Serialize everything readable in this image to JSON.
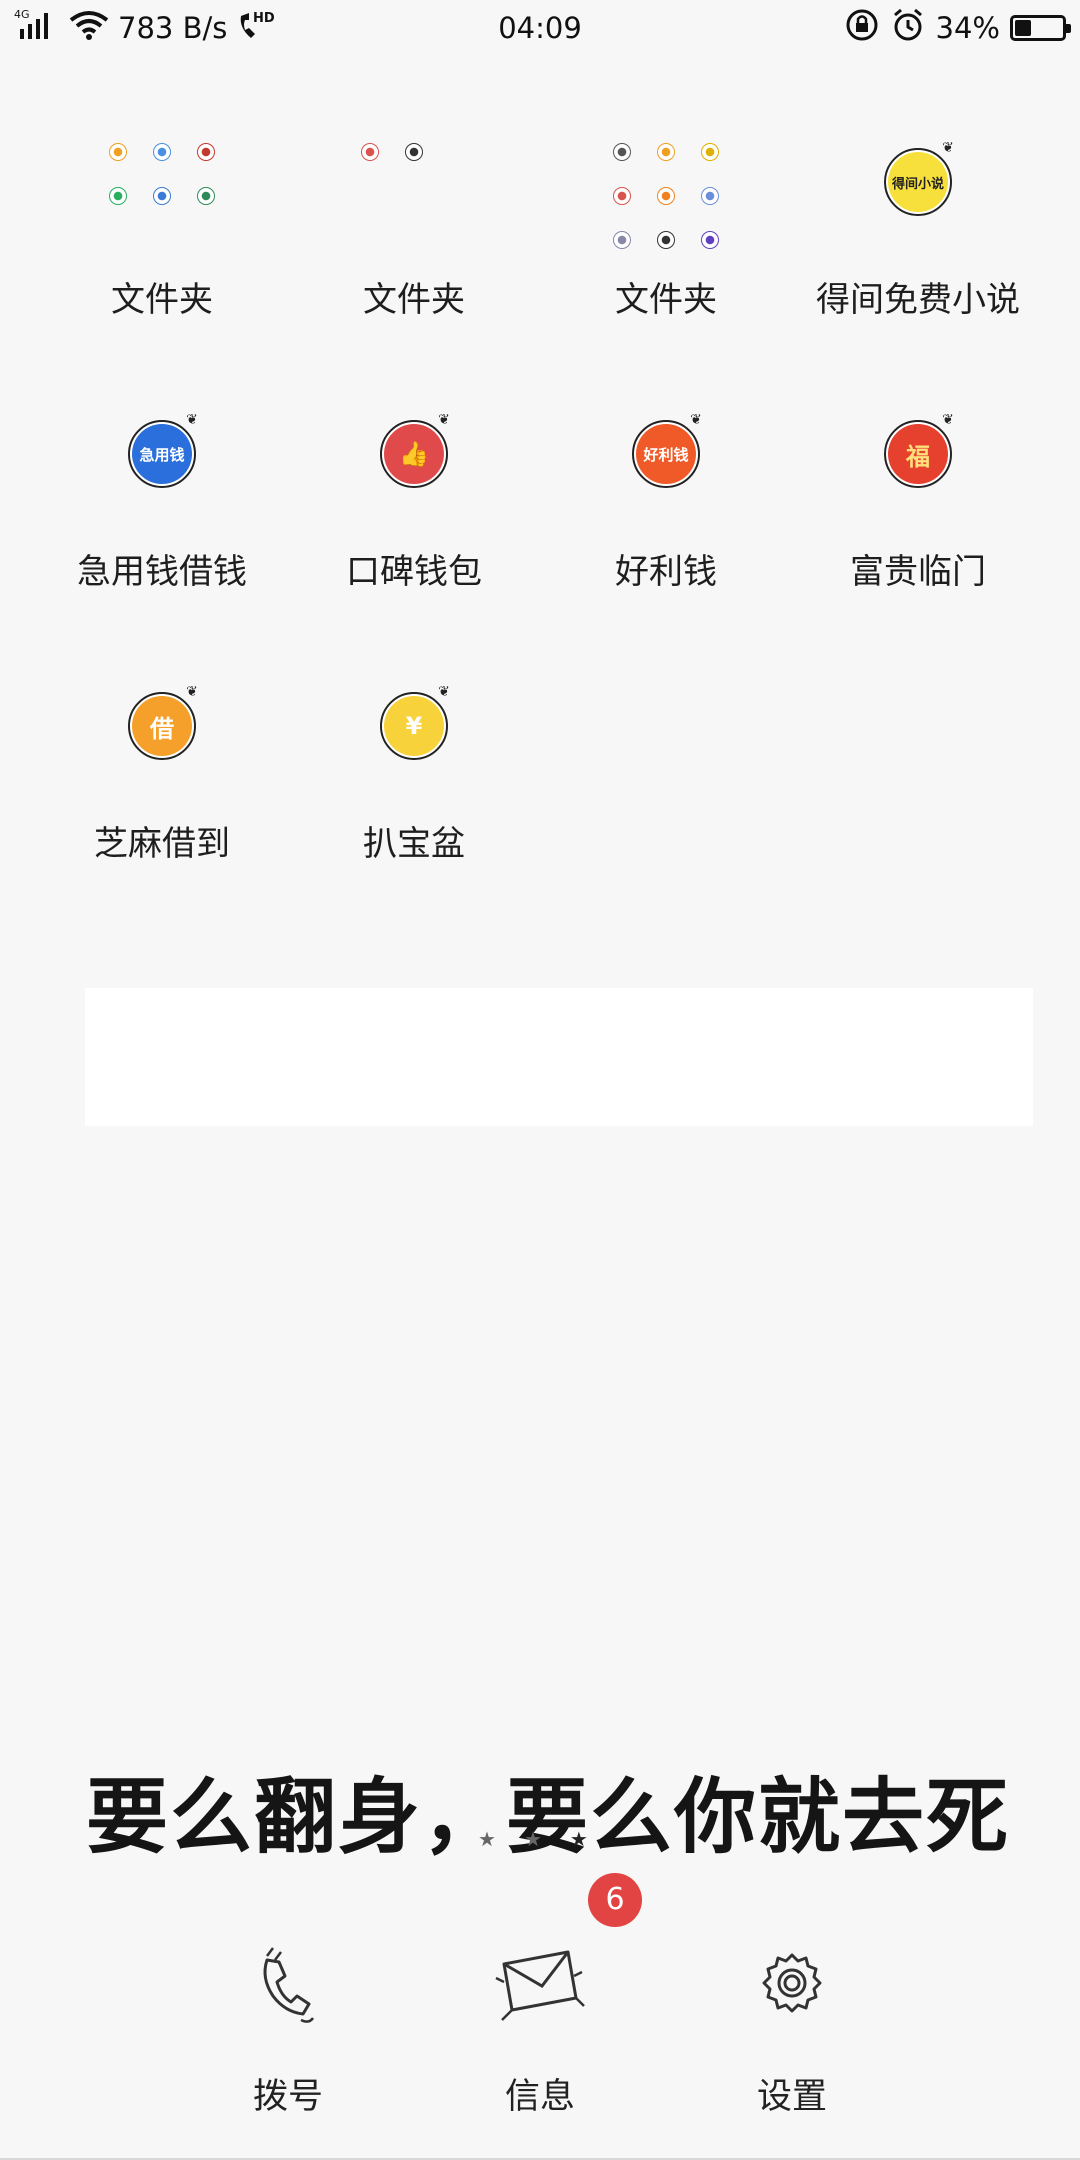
{
  "status_bar": {
    "network": "4G",
    "speed": "783 B/s",
    "hd": "HD",
    "time": "04:09",
    "battery_percent": "34%",
    "battery_level": 0.34,
    "icons": [
      "signal-icon",
      "wifi-icon",
      "hd-call-icon",
      "rotation-lock-icon",
      "alarm-icon",
      "battery-icon"
    ]
  },
  "apps": [
    {
      "label": "文件夹",
      "type": "folder",
      "minis": [
        "#f0a020",
        "#4a90e2",
        "#c0392b",
        "#27ae60",
        "#3a7bd5",
        "#2e8b57"
      ]
    },
    {
      "label": "文件夹",
      "type": "folder",
      "minis": [
        "#d9534f",
        "#333333"
      ]
    },
    {
      "label": "文件夹",
      "type": "folder",
      "minis": [
        "#555555",
        "#f0a020",
        "#e0b000",
        "#d9534f",
        "#f08020",
        "#6a8fd8",
        "#8888aa",
        "#333333",
        "#6040c0"
      ]
    },
    {
      "label": "得间免费小说",
      "type": "app",
      "icon_text": "得间小说",
      "color": "#f7e03c",
      "text_color": "#222222"
    },
    {
      "label": "急用钱借钱",
      "type": "app",
      "icon_text": "急用钱",
      "color": "#2a6fdb",
      "text_color": "#ffffff"
    },
    {
      "label": "口碑钱包",
      "type": "app",
      "icon_text": "👍",
      "color": "#e04a4a",
      "text_color": "#ffffff"
    },
    {
      "label": "好利钱",
      "type": "app",
      "icon_text": "好利钱",
      "color": "#f05a28",
      "text_color": "#ffffff"
    },
    {
      "label": "富贵临门",
      "type": "app",
      "icon_text": "福",
      "color": "#e6402e",
      "text_color": "#ffe07a"
    },
    {
      "label": "芝麻借到",
      "type": "app",
      "icon_text": "借",
      "color": "#f5a02a",
      "text_color": "#ffffff"
    },
    {
      "label": "扒宝盆",
      "type": "app",
      "icon_text": "¥",
      "color": "#f7d23a",
      "text_color": "#ffffff"
    }
  ],
  "quote": "要么翻身，要么你就去死",
  "dock": {
    "dialer": {
      "label": "拨号",
      "icon": "phone-icon"
    },
    "messages": {
      "label": "信息",
      "icon": "envelope-icon",
      "badge": "6"
    },
    "settings": {
      "label": "设置",
      "icon": "gear-icon"
    }
  }
}
